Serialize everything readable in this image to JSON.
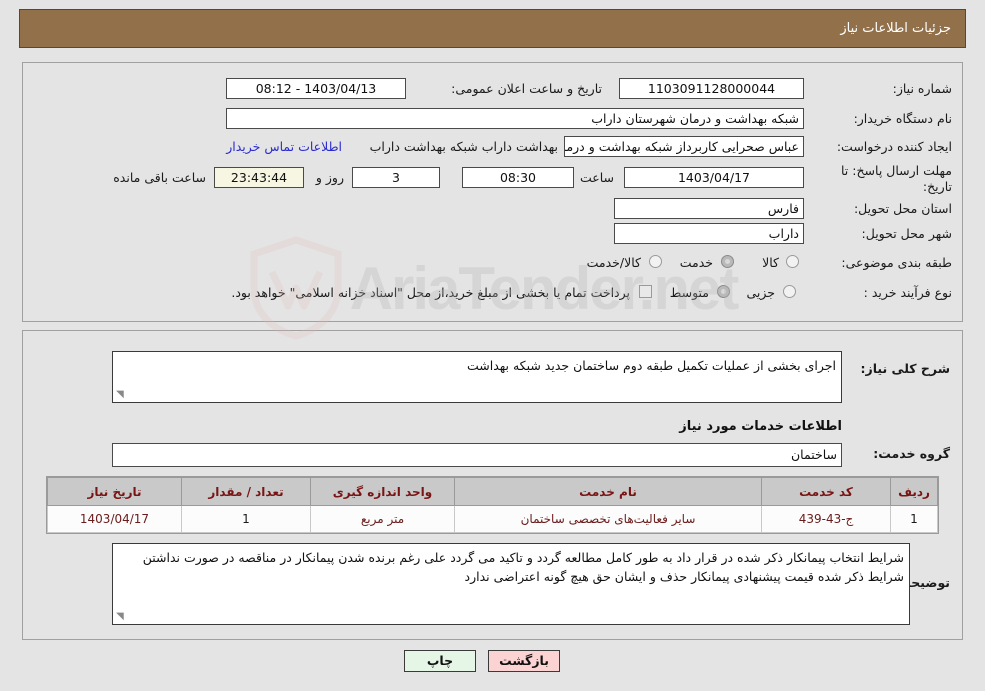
{
  "header": {
    "title": "جزئیات اطلاعات نیاز"
  },
  "colors": {
    "header_bg": "#91704a",
    "header_text": "#ffffff",
    "page_bg": "#e4e4e4",
    "panel_border": "#a0a0a0",
    "table_header_bg": "#c9c9c9",
    "table_header_text": "#7a1414",
    "table_cell_text": "#6a1b1b",
    "link_text": "#2b2bd0",
    "countdown_bg": "#f7f6e2",
    "print_button_bg": "#e6f6e6",
    "back_button_bg": "#fbd3d3"
  },
  "form": {
    "need_number_label": "شماره نیاز:",
    "need_number_value": "1103091128000044",
    "announce_datetime_label": "تاریخ و ساعت اعلان عمومی:",
    "announce_datetime_value": "1403/04/13 - 08:12",
    "buyer_org_label": "نام دستگاه خریدار:",
    "buyer_org_value": "شبکه بهداشت و درمان شهرستان داراب",
    "requester_label": "ایجاد کننده درخواست:",
    "requester_value": "عباس صحرایی کاربرداز شبکه بهداشت و درمان شهرستان",
    "requester_tail": "بهداشت داراب شبکه بهداشت داراب",
    "contact_link": "اطلاعات تماس خریدار",
    "deadline_label": "مهلت ارسال پاسخ: تا تاریخ:",
    "deadline_date": "1403/04/17",
    "deadline_hour_label": "ساعت",
    "deadline_hour_value": "08:30",
    "days_value": "3",
    "days_label": "روز و",
    "countdown_value": "23:43:44",
    "countdown_label": "ساعت باقی مانده",
    "province_label": "استان محل تحویل:",
    "province_value": "فارس",
    "city_label": "شهر محل تحویل:",
    "city_value": "داراب",
    "category_label": "طبقه بندی موضوعی:",
    "category_options": [
      {
        "label": "کالا",
        "checked": false
      },
      {
        "label": "خدمت",
        "checked": true
      },
      {
        "label": "کالا/خدمت",
        "checked": false
      }
    ],
    "process_label": "نوع فرآیند خرید :",
    "process_options": [
      {
        "label": "جزیی",
        "checked": false
      },
      {
        "label": "متوسط",
        "checked": true
      }
    ],
    "payment_checkbox_label": "پرداخت تمام یا بخشی از مبلغ خرید،از محل \"اسناد خزانه اسلامی\" خواهد بود.",
    "payment_checked": false
  },
  "details": {
    "summary_label": "شرح کلی نیاز:",
    "summary_value": "اجرای بخشی از عملیات تکمیل طبقه دوم ساختمان جدید شبکه بهداشت",
    "services_heading": "اطلاعات خدمات مورد نیاز",
    "service_group_label": "گروه خدمت:",
    "service_group_value": "ساختمان"
  },
  "table": {
    "columns": [
      "ردیف",
      "کد خدمت",
      "نام خدمت",
      "واحد اندازه گیری",
      "تعداد / مقدار",
      "تاریخ نیاز"
    ],
    "rows": [
      {
        "row_no": "1",
        "service_code": "ج-43-439",
        "service_name": "سایر فعالیت‌های تخصصی ساختمان",
        "unit": "متر مربع",
        "quantity": "1",
        "need_date": "1403/04/17"
      }
    ]
  },
  "notes": {
    "label": "توضیحات خریدار:",
    "text": "شرایط انتخاب پیمانکار ذکر شده در قرار داد به طور کامل مطالعه گردد و تاکید می گردد علی رغم برنده شدن پیمانکار در مناقصه در صورت نداشتن شرایط ذکر شده قیمت پیشنهادی پیمانکار حذف و ایشان حق هیچ گونه اعتراضی ندارد"
  },
  "footer": {
    "print_label": "چاپ",
    "back_label": "بازگشت"
  },
  "watermark": {
    "text_left": "AriaTender",
    "text_right": ".net"
  }
}
